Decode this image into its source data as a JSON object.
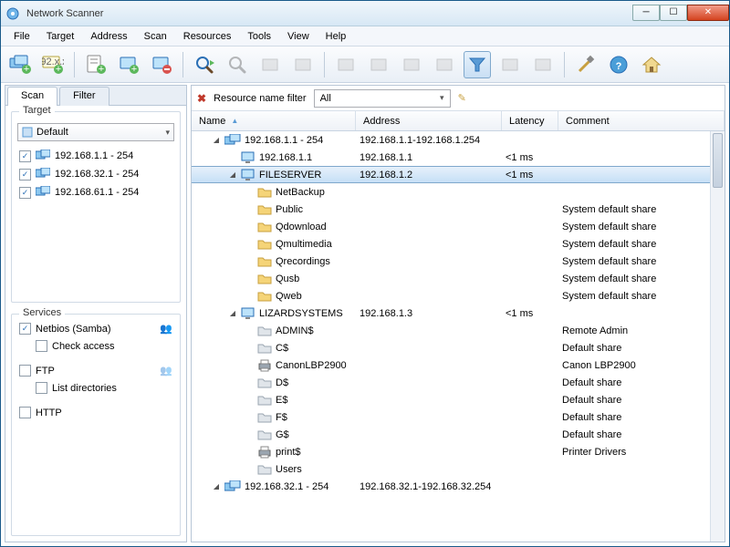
{
  "window": {
    "title": "Network Scanner"
  },
  "menu": [
    "File",
    "Target",
    "Address",
    "Scan",
    "Resources",
    "Tools",
    "View",
    "Help"
  ],
  "tabs": {
    "scan": "Scan",
    "filter": "Filter"
  },
  "target": {
    "title": "Target",
    "combo": "Default",
    "ranges": [
      "192.168.1.1 - 254",
      "192.168.32.1 - 254",
      "192.168.61.1 - 254"
    ]
  },
  "services": {
    "title": "Services",
    "netbios": "Netbios (Samba)",
    "check_access": "Check access",
    "ftp": "FTP",
    "list_dirs": "List directories",
    "http": "HTTP"
  },
  "filterbar": {
    "label": "Resource name filter",
    "value": "All"
  },
  "columns": {
    "name": "Name",
    "address": "Address",
    "latency": "Latency",
    "comment": "Comment"
  },
  "tree": [
    {
      "d": 1,
      "exp": "open",
      "icon": "monitors",
      "name": "192.168.1.1 - 254",
      "addr": "192.168.1.1-192.168.1.254",
      "lat": "",
      "com": ""
    },
    {
      "d": 2,
      "exp": "",
      "icon": "monitor",
      "name": "192.168.1.1",
      "addr": "192.168.1.1",
      "lat": "<1 ms",
      "com": ""
    },
    {
      "d": 2,
      "exp": "open",
      "icon": "monitor",
      "name": "FILESERVER",
      "addr": "192.168.1.2",
      "lat": "<1 ms",
      "com": "",
      "sel": true
    },
    {
      "d": 3,
      "exp": "",
      "icon": "folder",
      "name": "NetBackup",
      "addr": "",
      "lat": "",
      "com": ""
    },
    {
      "d": 3,
      "exp": "",
      "icon": "folder",
      "name": "Public",
      "addr": "",
      "lat": "",
      "com": "System default share"
    },
    {
      "d": 3,
      "exp": "",
      "icon": "folder",
      "name": "Qdownload",
      "addr": "",
      "lat": "",
      "com": "System default share"
    },
    {
      "d": 3,
      "exp": "",
      "icon": "folder",
      "name": "Qmultimedia",
      "addr": "",
      "lat": "",
      "com": "System default share"
    },
    {
      "d": 3,
      "exp": "",
      "icon": "folder",
      "name": "Qrecordings",
      "addr": "",
      "lat": "",
      "com": "System default share"
    },
    {
      "d": 3,
      "exp": "",
      "icon": "folder",
      "name": "Qusb",
      "addr": "",
      "lat": "",
      "com": "System default share"
    },
    {
      "d": 3,
      "exp": "",
      "icon": "folder",
      "name": "Qweb",
      "addr": "",
      "lat": "",
      "com": "System default share"
    },
    {
      "d": 2,
      "exp": "open",
      "icon": "monitor",
      "name": "LIZARDSYSTEMS",
      "addr": "192.168.1.3",
      "lat": "<1 ms",
      "com": ""
    },
    {
      "d": 3,
      "exp": "",
      "icon": "folder-g",
      "name": "ADMIN$",
      "addr": "",
      "lat": "",
      "com": "Remote Admin"
    },
    {
      "d": 3,
      "exp": "",
      "icon": "folder-g",
      "name": "C$",
      "addr": "",
      "lat": "",
      "com": "Default share"
    },
    {
      "d": 3,
      "exp": "",
      "icon": "printer",
      "name": "CanonLBP2900",
      "addr": "",
      "lat": "",
      "com": "Canon LBP2900"
    },
    {
      "d": 3,
      "exp": "",
      "icon": "folder-g",
      "name": "D$",
      "addr": "",
      "lat": "",
      "com": "Default share"
    },
    {
      "d": 3,
      "exp": "",
      "icon": "folder-g",
      "name": "E$",
      "addr": "",
      "lat": "",
      "com": "Default share"
    },
    {
      "d": 3,
      "exp": "",
      "icon": "folder-g",
      "name": "F$",
      "addr": "",
      "lat": "",
      "com": "Default share"
    },
    {
      "d": 3,
      "exp": "",
      "icon": "folder-g",
      "name": "G$",
      "addr": "",
      "lat": "",
      "com": "Default share"
    },
    {
      "d": 3,
      "exp": "",
      "icon": "printer",
      "name": "print$",
      "addr": "",
      "lat": "",
      "com": "Printer Drivers"
    },
    {
      "d": 3,
      "exp": "",
      "icon": "folder-g",
      "name": "Users",
      "addr": "",
      "lat": "",
      "com": ""
    },
    {
      "d": 1,
      "exp": "open",
      "icon": "monitors",
      "name": "192.168.32.1 - 254",
      "addr": "192.168.32.1-192.168.32.254",
      "lat": "",
      "com": ""
    }
  ]
}
